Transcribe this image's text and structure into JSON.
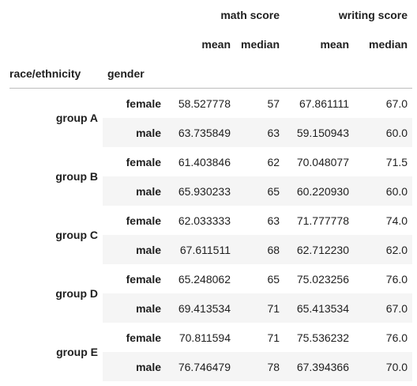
{
  "table": {
    "column_groups": [
      {
        "label": "math score"
      },
      {
        "label": "writing score"
      }
    ],
    "sub_columns": [
      "mean",
      "median",
      "mean",
      "median"
    ],
    "index_names": [
      "race/ethnicity",
      "gender"
    ],
    "groups": [
      {
        "race": "group A",
        "rows": [
          {
            "gender": "female",
            "math_mean": "58.527778",
            "math_median": "57",
            "writing_mean": "67.861111",
            "writing_median": "67.0"
          },
          {
            "gender": "male",
            "math_mean": "63.735849",
            "math_median": "63",
            "writing_mean": "59.150943",
            "writing_median": "60.0"
          }
        ]
      },
      {
        "race": "group B",
        "rows": [
          {
            "gender": "female",
            "math_mean": "61.403846",
            "math_median": "62",
            "writing_mean": "70.048077",
            "writing_median": "71.5"
          },
          {
            "gender": "male",
            "math_mean": "65.930233",
            "math_median": "65",
            "writing_mean": "60.220930",
            "writing_median": "60.0"
          }
        ]
      },
      {
        "race": "group C",
        "rows": [
          {
            "gender": "female",
            "math_mean": "62.033333",
            "math_median": "63",
            "writing_mean": "71.777778",
            "writing_median": "74.0"
          },
          {
            "gender": "male",
            "math_mean": "67.611511",
            "math_median": "68",
            "writing_mean": "62.712230",
            "writing_median": "62.0"
          }
        ]
      },
      {
        "race": "group D",
        "rows": [
          {
            "gender": "female",
            "math_mean": "65.248062",
            "math_median": "65",
            "writing_mean": "75.023256",
            "writing_median": "76.0"
          },
          {
            "gender": "male",
            "math_mean": "69.413534",
            "math_median": "71",
            "writing_mean": "65.413534",
            "writing_median": "67.0"
          }
        ]
      },
      {
        "race": "group E",
        "rows": [
          {
            "gender": "female",
            "math_mean": "70.811594",
            "math_median": "71",
            "writing_mean": "75.536232",
            "writing_median": "76.0"
          },
          {
            "gender": "male",
            "math_mean": "76.746479",
            "math_median": "78",
            "writing_mean": "67.394366",
            "writing_median": "70.0"
          }
        ]
      }
    ],
    "colors": {
      "stripe": "#f5f5f5",
      "border": "#bdbdbd",
      "text": "#1f1f1f"
    }
  }
}
